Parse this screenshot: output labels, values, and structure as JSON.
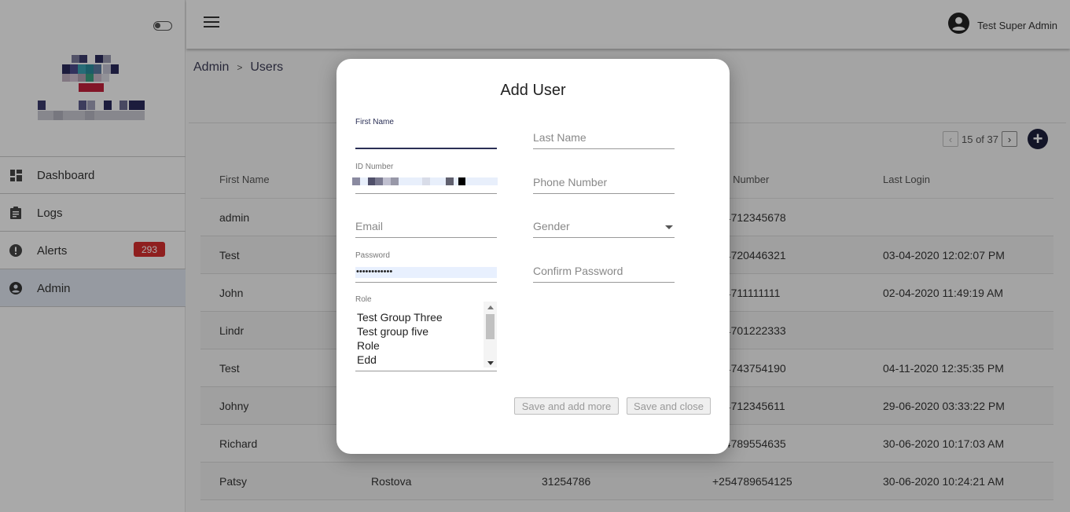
{
  "sidebar": {
    "items": [
      {
        "label": "Dashboard",
        "icon": "dashboard-icon"
      },
      {
        "label": "Logs",
        "icon": "clipboard-icon"
      },
      {
        "label": "Alerts",
        "icon": "alert-icon",
        "badge": "293"
      },
      {
        "label": "Admin",
        "icon": "account-circle-icon"
      }
    ]
  },
  "topbar": {
    "user_name": "Test Super Admin"
  },
  "breadcrumb": {
    "root": "Admin",
    "separator": ">",
    "current": "Users"
  },
  "pagination": {
    "prev": "‹",
    "text": "15 of 37",
    "next": "›"
  },
  "add_button": "+",
  "table": {
    "headers": [
      "First Name",
      "",
      "",
      "ne Number",
      "Last Login"
    ],
    "rows": [
      {
        "first": "admin",
        "last": "",
        "id": "",
        "phone": "54712345678",
        "login": ""
      },
      {
        "first": "Test",
        "last": "",
        "id": "",
        "phone": "54720446321",
        "login": "03-04-2020 12:02:07 PM"
      },
      {
        "first": "John",
        "last": "",
        "id": "",
        "phone": "54711111111",
        "login": "02-04-2020 11:49:19 AM"
      },
      {
        "first": "Lindr",
        "last": "",
        "id": "",
        "phone": "54701222333",
        "login": ""
      },
      {
        "first": "Test",
        "last": "",
        "id": "",
        "phone": "54743754190",
        "login": "04-11-2020 12:35:35 PM"
      },
      {
        "first": "Johny",
        "last": "",
        "id": "",
        "phone": "54712345611",
        "login": "29-06-2020 03:33:22 PM"
      },
      {
        "first": "Richard",
        "last": "",
        "id": "",
        "phone": "54789554635",
        "login": "30-06-2020 10:17:03 AM"
      },
      {
        "first": "Patsy",
        "last": "Rostova",
        "id": "31254786",
        "phone": "+254789654125",
        "login": "30-06-2020 10:24:21 AM"
      }
    ]
  },
  "dialog": {
    "title": "Add User",
    "first_name_label": "First Name",
    "last_name_label": "Last Name",
    "id_number_label": "ID Number",
    "phone_label": "Phone Number",
    "email_label": "Email",
    "gender_label": "Gender",
    "password_label": "Password",
    "password_value": "••••••••••••",
    "confirm_password_label": "Confirm Password",
    "role_label": "Role",
    "role_options": [
      "Test Group Three",
      "Test group five",
      "Role",
      "Edd"
    ],
    "save_add_more": "Save and add more",
    "save_close": "Save and close"
  },
  "colors": {
    "accent": "#1c1f3b",
    "badge": "#d32f2f",
    "active_nav": "#dde4ee"
  }
}
